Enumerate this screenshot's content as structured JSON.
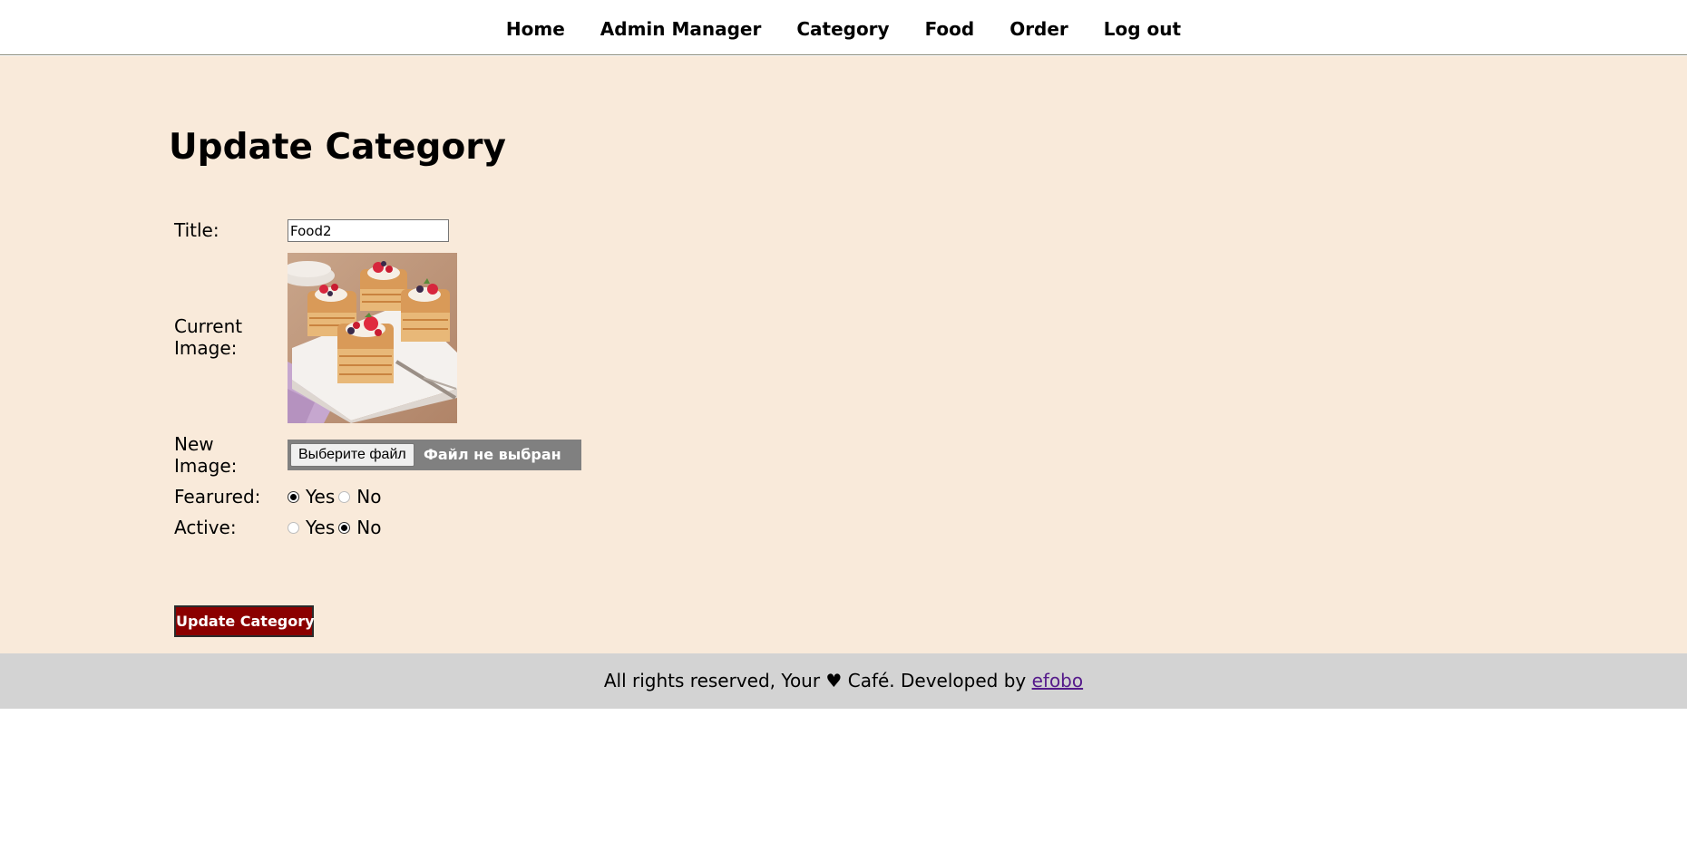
{
  "nav": {
    "items": [
      "Home",
      "Admin Manager",
      "Category",
      "Food",
      "Order",
      "Log out"
    ]
  },
  "page": {
    "title": "Update Category"
  },
  "form": {
    "title_label": "Title:",
    "title_value": "Food2",
    "current_image_label_line1": "Current",
    "current_image_label_line2": "Image:",
    "new_image_label_line1": "New",
    "new_image_label_line2": "Image:",
    "file_button_label": "Выберите файл",
    "file_status": "Файл не выбран",
    "featured_label": "Fearured:",
    "featured_yes": "Yes",
    "featured_no": "No",
    "featured_selected": "Yes",
    "active_label": "Active:",
    "active_yes": "Yes",
    "active_no": "No",
    "active_selected": "No",
    "submit_label": "Update Category"
  },
  "footer": {
    "text": "All rights reserved, Your ♥ Café. Developed by ",
    "link_text": "efobo"
  },
  "colors": {
    "main_background": "#f9eada",
    "footer_background": "#d3d3d3",
    "submit_background": "#8b0000",
    "file_bar_background": "#808080",
    "link_color": "#551a8b"
  }
}
